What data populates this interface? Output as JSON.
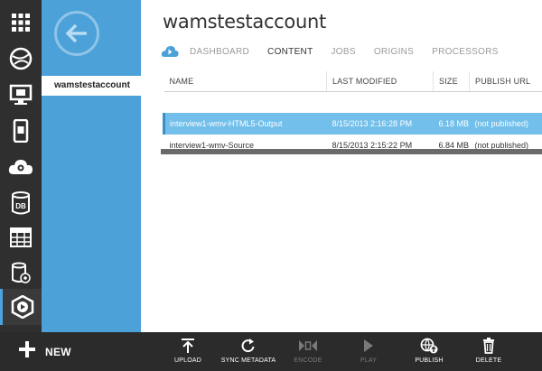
{
  "rail": {
    "items": [
      {
        "icon": "all-items-grid-icon"
      },
      {
        "icon": "web-sites-icon"
      },
      {
        "icon": "virtual-machines-icon"
      },
      {
        "icon": "mobile-services-icon"
      },
      {
        "icon": "cloud-services-icon"
      },
      {
        "icon": "sql-databases-icon",
        "text": "DB"
      },
      {
        "icon": "storage-icon"
      },
      {
        "icon": "hdinsight-icon"
      },
      {
        "icon": "media-services-icon",
        "active": true
      }
    ]
  },
  "nav": {
    "back_icon": "back-arrow-icon",
    "selected_item": "wamstestaccount"
  },
  "main": {
    "title": "wamstestaccount",
    "tab_icon": "media-cloud-icon",
    "tabs": [
      {
        "label": "DASHBOARD",
        "active": false
      },
      {
        "label": "CONTENT",
        "active": true
      },
      {
        "label": "JOBS",
        "active": false
      },
      {
        "label": "ORIGINS",
        "active": false
      },
      {
        "label": "PROCESSORS",
        "active": false
      }
    ],
    "table": {
      "columns": [
        "NAME",
        "LAST MODIFIED",
        "SIZE",
        "PUBLISH URL"
      ],
      "rows": [
        {
          "name": "interview1-wmv-HTML5-Output",
          "modified": "8/15/2013 2:16:28 PM",
          "size": "6.18 MB",
          "publish_url": "(not published)",
          "selected": true
        },
        {
          "name": "interview1-wmv-Source",
          "modified": "8/15/2013 2:15:22 PM",
          "size": "6.84 MB",
          "publish_url": "(not published)",
          "selected": false
        }
      ]
    }
  },
  "cmdbar": {
    "new_label": "NEW",
    "commands": [
      {
        "label": "UPLOAD",
        "icon": "upload-icon",
        "enabled": true
      },
      {
        "label": "SYNC METADATA",
        "icon": "sync-icon",
        "enabled": true
      },
      {
        "label": "ENCODE",
        "icon": "encode-icon",
        "enabled": false
      },
      {
        "label": "PLAY",
        "icon": "play-icon",
        "enabled": false
      },
      {
        "label": "PUBLISH",
        "icon": "publish-icon",
        "enabled": true
      },
      {
        "label": "DELETE",
        "icon": "delete-icon",
        "enabled": true
      }
    ]
  },
  "colors": {
    "rail_bg": "#2f2f2f",
    "panel_blue": "#4ba1d8",
    "selected_row": "#71bfea",
    "cmdbar_bg": "#2b2b2b"
  }
}
